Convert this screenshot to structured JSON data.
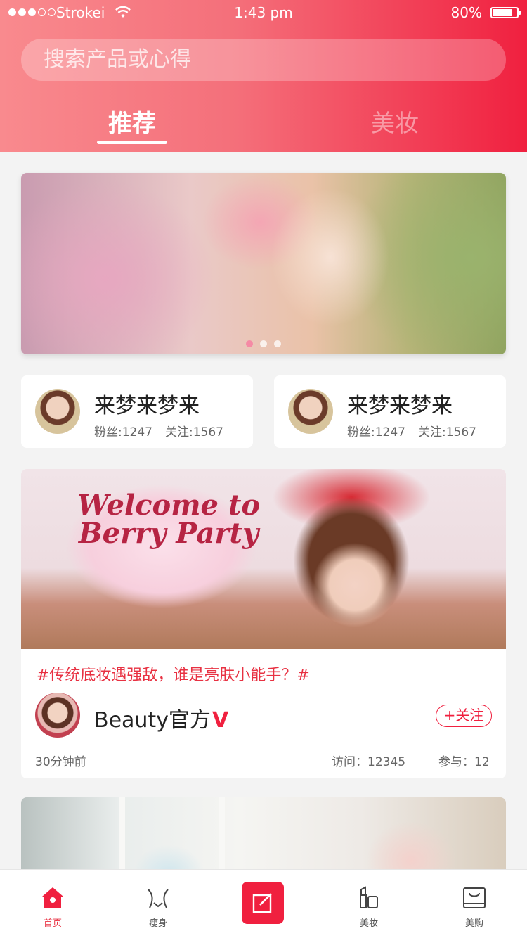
{
  "status_bar": {
    "carrier": "Strokei",
    "time": "1:43 pm",
    "battery": "80%"
  },
  "search": {
    "placeholder": "搜索产品或心得"
  },
  "tabs": [
    {
      "label": "推荐",
      "active": true
    },
    {
      "label": "美妆",
      "active": false
    }
  ],
  "banner": {
    "page_count": 3,
    "active_page": 1
  },
  "user_cards": [
    {
      "name": "来梦来梦来",
      "fans": "粉丝:1247",
      "follows": "关注:1567"
    },
    {
      "name": "来梦来梦来",
      "fans": "粉丝:1247",
      "follows": "关注:1567"
    }
  ],
  "post": {
    "image_text": "Welcome to Berry Party",
    "tag": "#传统底妆遇强敌，谁是亮肤小能手？#",
    "author": "Beauty官方",
    "verified_mark": "V",
    "follow_label": "+关注",
    "time": "30分钟前",
    "visits": "访问：12345",
    "participants": "参与：12"
  },
  "tab_bar": {
    "items": [
      {
        "label": "首页",
        "icon": "home-icon",
        "active": true
      },
      {
        "label": "瘦身",
        "icon": "slim-icon",
        "active": false
      },
      {
        "label": "",
        "icon": "edit-icon",
        "active": false
      },
      {
        "label": "美妆",
        "icon": "cosmetics-icon",
        "active": false
      },
      {
        "label": "美购",
        "icon": "shopping-bag-icon",
        "active": false
      }
    ]
  },
  "colors": {
    "accent": "#f0203f",
    "header_gradient_start": "#f98a8e",
    "header_gradient_end": "#f0203f",
    "tag_text": "#e83142"
  }
}
